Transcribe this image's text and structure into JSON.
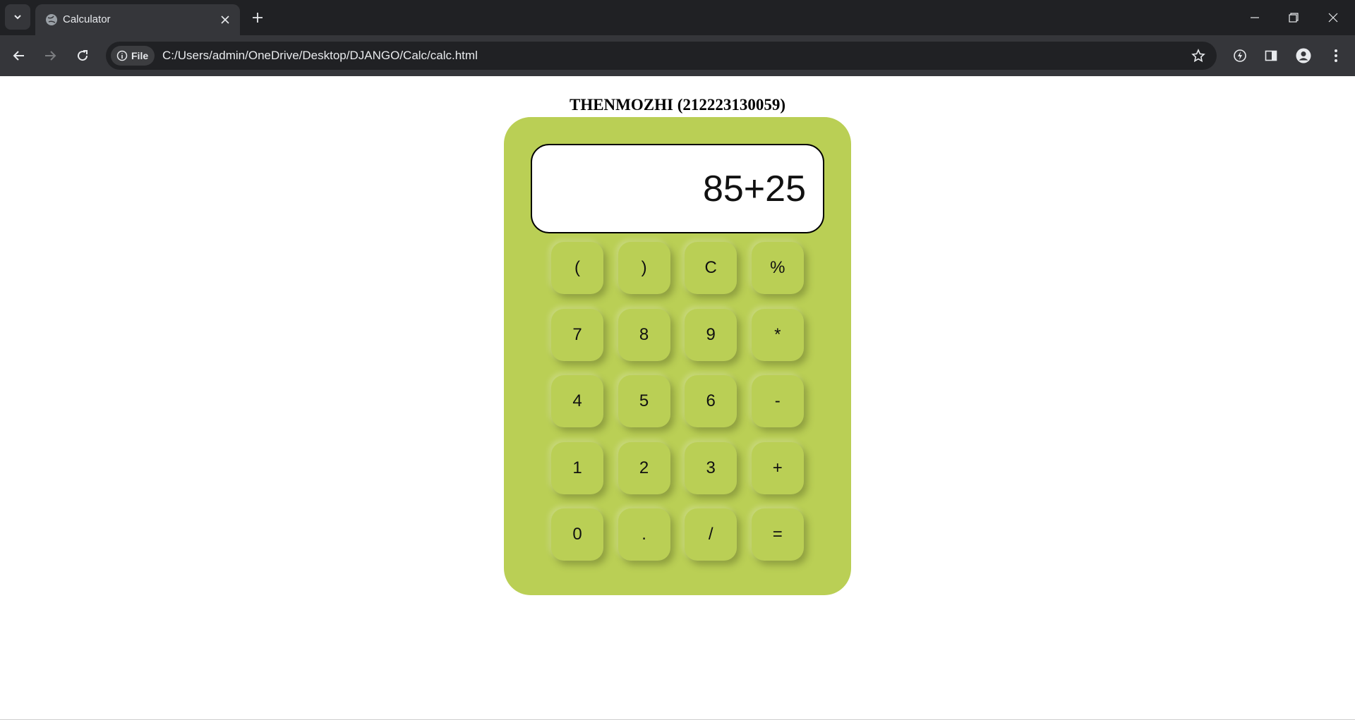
{
  "browser": {
    "tab_title": "Calculator",
    "chip_label": "File",
    "url": "C:/Users/admin/OneDrive/Desktop/DJANGO/Calc/calc.html"
  },
  "page": {
    "heading": "THENMOZHI (212223130059)"
  },
  "calculator": {
    "display": "85+25",
    "keys": [
      [
        "(",
        ")",
        "C",
        "%"
      ],
      [
        "7",
        "8",
        "9",
        "*"
      ],
      [
        "4",
        "5",
        "6",
        "-"
      ],
      [
        "1",
        "2",
        "3",
        "+"
      ],
      [
        "0",
        ".",
        "/",
        "="
      ]
    ],
    "body_color": "#bacf55"
  }
}
